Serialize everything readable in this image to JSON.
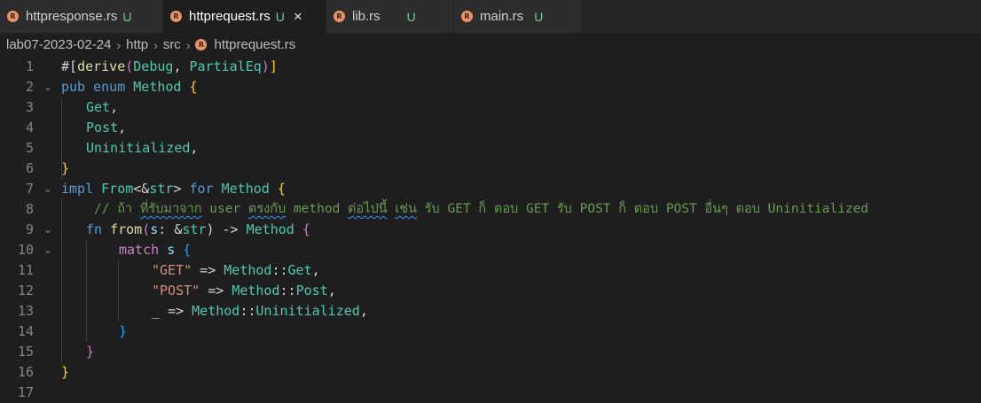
{
  "tabs": [
    {
      "label": "httpresponse.rs",
      "badge": "U",
      "active": false
    },
    {
      "label": "httprequest.rs",
      "badge": "U",
      "active": true,
      "close": "×"
    },
    {
      "label": "lib.rs",
      "badge": "U",
      "active": false
    },
    {
      "label": "main.rs",
      "badge": "U",
      "active": false
    }
  ],
  "breadcrumb": {
    "root": "lab07-2023-02-24",
    "folder1": "http",
    "folder2": "src",
    "file": "httprequest.rs",
    "sep": "›"
  },
  "file_icon_text": "R",
  "fold_icon": "⌄",
  "line_numbers": [
    "1",
    "2",
    "3",
    "4",
    "5",
    "6",
    "7",
    "8",
    "9",
    "10",
    "11",
    "12",
    "13",
    "14",
    "15",
    "16",
    "17"
  ],
  "code": {
    "l1": {
      "a": "#[",
      "b": "derive",
      "c": "(",
      "d": "Debug",
      "e": ", ",
      "f": "PartialEq",
      "g": ")",
      "h": "]"
    },
    "l2": {
      "a": "pub",
      "b": " ",
      "c": "enum",
      "d": " ",
      "e": "Method",
      "f": " ",
      "g": "{"
    },
    "l3": {
      "a": "Get",
      "b": ","
    },
    "l4": {
      "a": "Post",
      "b": ","
    },
    "l5": {
      "a": "Uninitialized",
      "b": ","
    },
    "l6": {
      "a": "}"
    },
    "l7": {
      "a": "impl",
      "b": " ",
      "c": "From",
      "d": "<&",
      "e": "str",
      "f": "> ",
      "g": "for",
      "h": " ",
      "i": "Method",
      "j": " ",
      "k": "{"
    },
    "l8": {
      "a": "// ถ้า ",
      "b": "ที่รับมาจาก",
      "c": " user ",
      "d": "ตรงกับ",
      "e": " method ",
      "f": "ต่อไปนี้",
      "g": " ",
      "h": "เช่น",
      "i": " รับ GET ก็ ตอบ GET รับ POST ก็ ตอบ POST อื่นๆ ตอบ Uninitialized"
    },
    "l9": {
      "a": "fn",
      "b": " ",
      "c": "from",
      "d": "(",
      "e": "s",
      "f": ": &",
      "g": "str",
      "h": ") -> ",
      "i": "Method",
      "j": " ",
      "k": "{"
    },
    "l10": {
      "a": "match",
      "b": " ",
      "c": "s",
      "d": " ",
      "e": "{"
    },
    "l11": {
      "a": "\"GET\"",
      "b": " => ",
      "c": "Method",
      "d": "::",
      "e": "Get",
      "f": ","
    },
    "l12": {
      "a": "\"POST\"",
      "b": " => ",
      "c": "Method",
      "d": "::",
      "e": "Post",
      "f": ","
    },
    "l13": {
      "a": "_",
      "b": " => ",
      "c": "Method",
      "d": "::",
      "e": "Uninitialized",
      "f": ","
    },
    "l14": {
      "a": "}"
    },
    "l15": {
      "a": "}"
    },
    "l16": {
      "a": "}"
    }
  },
  "colors": {
    "keyword": "#569cd6",
    "type": "#4ec9b0",
    "function": "#dcdcaa",
    "string": "#ce9178",
    "comment": "#6a9955",
    "untracked_badge": "#73c991",
    "rust_icon": "#e8946a"
  }
}
